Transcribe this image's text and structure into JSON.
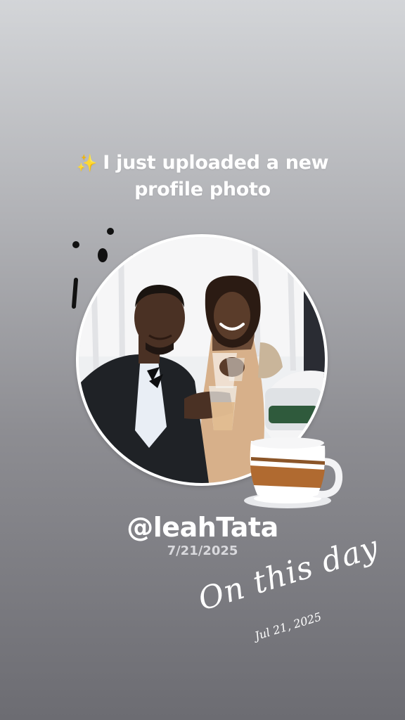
{
  "story": {
    "headline_sparkle": "✨",
    "headline_line1": "I just uploaded a new",
    "headline_line2": "profile photo",
    "username": "@leahTata",
    "post_date": "7/21/2025",
    "sticker_text": "On this day",
    "memory_date": "Jul 21, 2025"
  },
  "colors": {
    "background_top": "#d3d5d8",
    "background_bottom": "#6c6c72",
    "text": "#ffffff",
    "sparkle": "#f4d24c"
  },
  "icons": {
    "sparkle": "sparkles-icon",
    "coffee": "coffee-cup-icon",
    "doodle": "doodle-icon"
  }
}
